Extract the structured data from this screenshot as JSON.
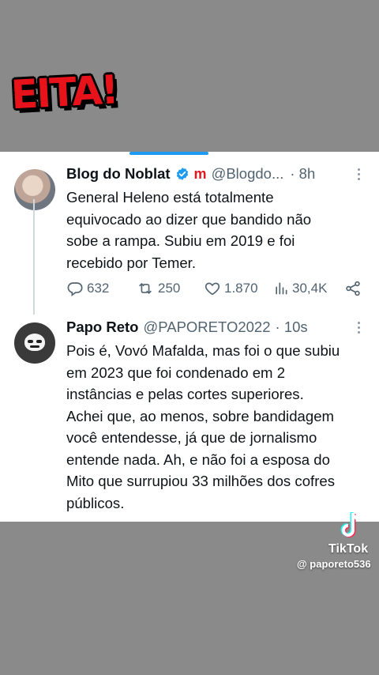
{
  "banner": {
    "text": "EITA!"
  },
  "tweets": [
    {
      "name": "Blog do Noblat",
      "affiliate_badge": "m",
      "handle": "@Blogdo...",
      "time": "· 8h",
      "avatar_icon": "profile-photo",
      "verified": true,
      "body_lines": [
        "General Heleno está totalmente",
        "equivocado ao dizer que bandido não",
        "sobe a rampa. Subiu em 2019 e foi",
        "recebido por Temer."
      ],
      "actions": {
        "replies": "632",
        "retweets": "250",
        "likes": "1.870",
        "views": "30,4K"
      }
    },
    {
      "name": "Papo Reto",
      "handle": "@PAPORETO2022",
      "time": "· 10s",
      "avatar_icon": "masked-face-avatar",
      "body_lines": [
        "Pois é, Vovó Mafalda, mas foi o que subiu",
        "em 2023 que foi condenado em 2",
        "instâncias e pelas cortes superiores.",
        "Achei que, ao menos, sobre bandidagem",
        "você entendesse, já que de jornalismo",
        "entende nada. Ah, e não foi a esposa do",
        "Mito que surrupiou 33 milhões dos cofres",
        "públicos."
      ]
    }
  ],
  "watermark": {
    "brand": "TikTok",
    "user": "@ paporeto536"
  },
  "colors": {
    "accent": "#1d9bf0",
    "background": "#8a8a8a",
    "banner": "#e8121b",
    "muted_text": "#536471"
  }
}
